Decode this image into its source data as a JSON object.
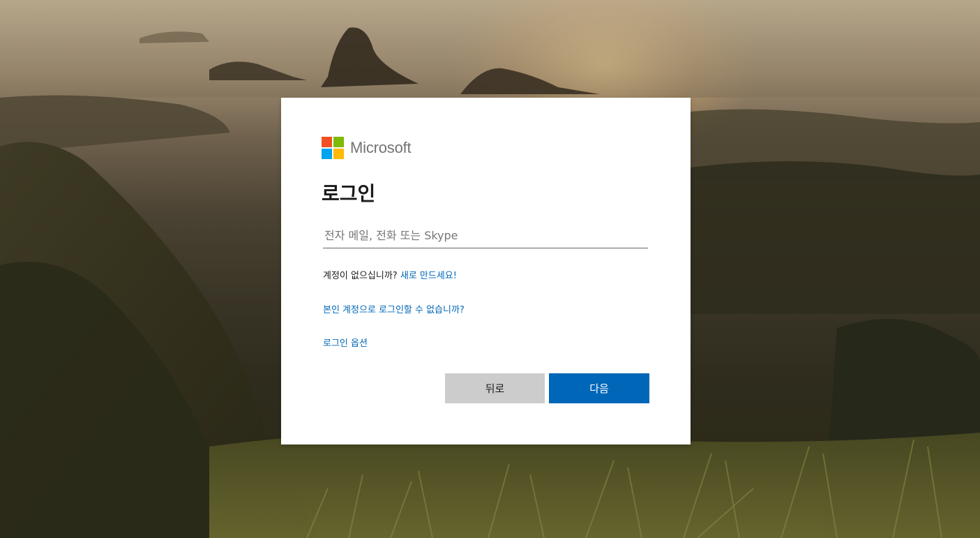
{
  "brand": {
    "logo_text": "Microsoft",
    "colors": {
      "red": "#f25022",
      "green": "#7fba00",
      "blue": "#00a4ef",
      "yellow": "#ffb900",
      "accent": "#0067b8"
    }
  },
  "signin": {
    "title": "로그인",
    "email_placeholder": "전자 메일, 전화 또는 Skype",
    "email_value": "",
    "no_account_text": "계정이 없으십니까? ",
    "create_link": "새로 만드세요!",
    "cant_access_link": "본인 계정으로 로그인할 수 없습니까?",
    "signin_options_link": "로그인 옵션",
    "back_button": "뒤로",
    "next_button": "다음"
  }
}
